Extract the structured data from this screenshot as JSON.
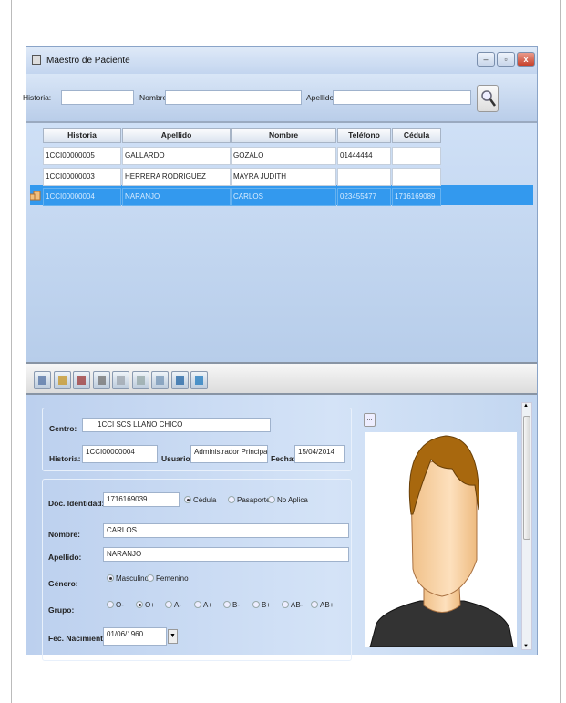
{
  "window": {
    "title": "Maestro de Paciente",
    "minimize": "–",
    "maximize": "▫",
    "close": "x"
  },
  "search": {
    "historia_label": "Historia:",
    "historia_value": "",
    "nombre_label": "Nombre:",
    "nombre_value": "",
    "apellido_label": "Apellido:",
    "apellido_value": "",
    "search_icon": "magnifier-icon"
  },
  "grid": {
    "columns": [
      "Historia",
      "Apellido",
      "Nombre",
      "Teléfono",
      "Cédula"
    ],
    "rows": [
      [
        "1CCI00000005",
        "GALLARDO",
        "GOZALO",
        "01444444",
        ""
      ],
      [
        "1CCI00000003",
        "HERRERA RODRIGUEZ",
        "MAYRA JUDITH",
        "",
        ""
      ],
      [
        "1CCI00000004",
        "NARANJO",
        "CARLOS",
        "023455477",
        "1716169089"
      ]
    ],
    "selected_row": 2,
    "selection_color": "#3399ee"
  },
  "toolbar": {
    "icons": [
      "save-icon",
      "edit-icon",
      "delete-icon",
      "list-icon",
      "document-icon",
      "preview-icon",
      "print-icon",
      "import-icon",
      "export-icon"
    ]
  },
  "detail": {
    "centro_label": "Centro:",
    "centro_value": "1CCI  SCS LLANO CHICO",
    "historia_label": "Historia:",
    "historia_value": "1CCI00000004",
    "usuario_label": "Usuario:",
    "usuario_value": "Administrador  Principal",
    "fecha_label": "Fecha:",
    "fecha_value": "15/04/2014",
    "doc_label": "Doc. Identidad:",
    "doc_value": "1716169039",
    "doc_types": [
      "Cédula",
      "Pasaporte",
      "No Aplica"
    ],
    "doc_selected": "Cédula",
    "nombre_label": "Nombre:",
    "nombre_value": "CARLOS",
    "apellido_label": "Apellido:",
    "apellido_value": "NARANJO",
    "genero_label": "Género:",
    "generos": [
      "Masculino",
      "Femenino"
    ],
    "genero_selected": "Masculino",
    "grupo_label": "Grupo:",
    "grupos": [
      "O-",
      "O+",
      "A-",
      "A+",
      "B-",
      "B+",
      "AB-",
      "AB+"
    ],
    "grupo_selected": "O+",
    "nacimiento_label": "Fec. Nacimiento:",
    "nacimiento_value": "01/06/1960",
    "photo_button": "..."
  }
}
